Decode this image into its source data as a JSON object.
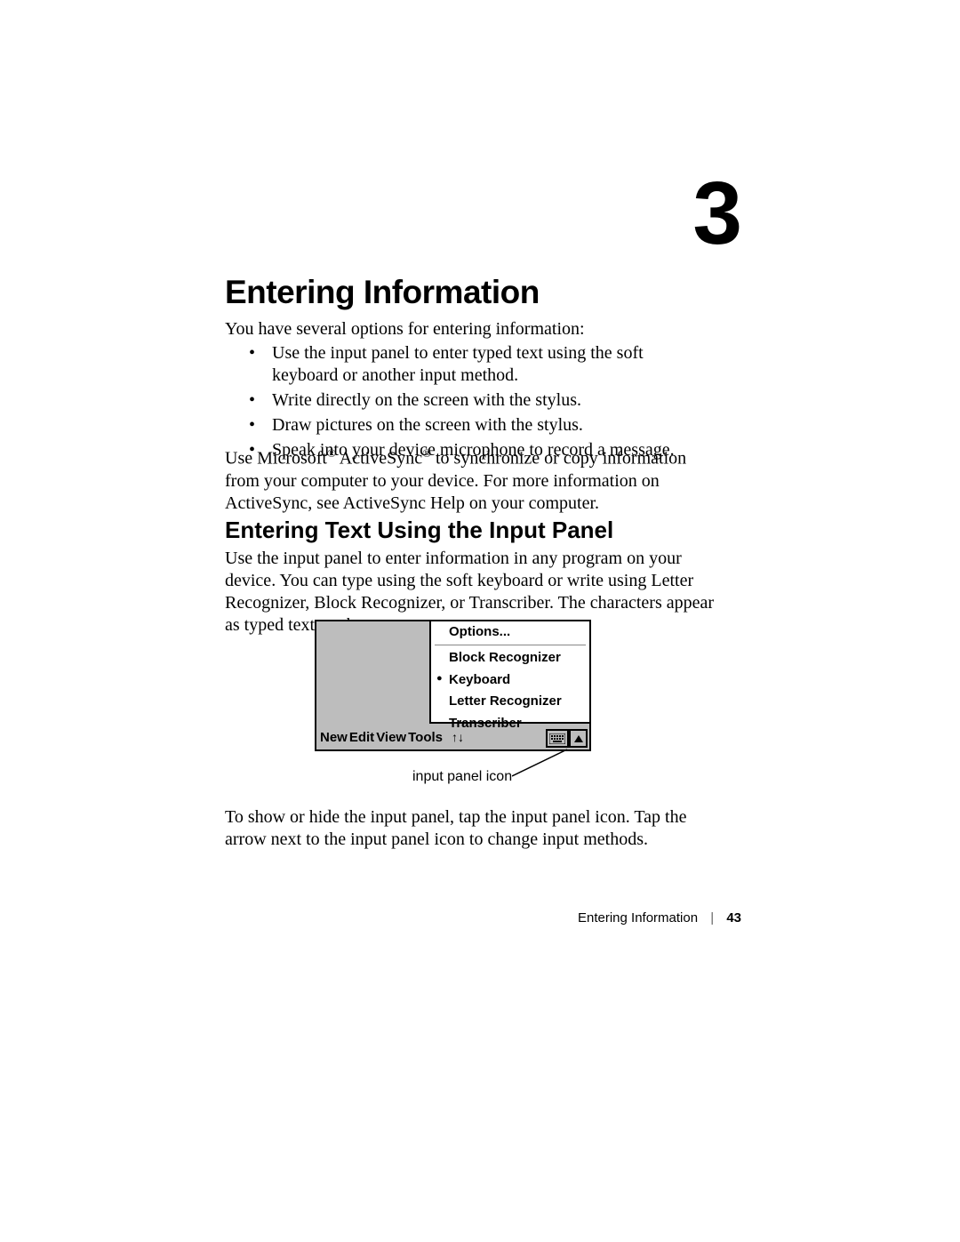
{
  "chapter_number": "3",
  "heading": "Entering Information",
  "intro_line": "You have several options for entering information:",
  "bullets": [
    "Use the input panel to enter typed text using the soft keyboard or another input method.",
    "Write directly on the screen with the stylus.",
    "Draw pictures on the screen with the stylus.",
    "Speak into your device microphone to record a message."
  ],
  "after_list_pre": "Use Microsoft",
  "after_list_mid1": " ActiveSync",
  "after_list_post": " to synchronize or copy information from your computer to your device. For more information on ActiveSync, see ActiveSync Help on your computer.",
  "reg_mark": "®",
  "sub_heading": "Entering Text Using the Input Panel",
  "sub_body": "Use the input panel to enter information in any program on your device. You can type using the soft keyboard or write using Letter Recognizer, Block Recognizer, or Transcriber. The characters appear as typed text on the screen.",
  "ppc": {
    "bar_items": [
      "New",
      "Edit",
      "View",
      "Tools"
    ],
    "updown_glyph": "↑↓",
    "popup": {
      "options": "Options...",
      "items": [
        "Block Recognizer",
        "Keyboard",
        "Letter Recognizer",
        "Transcriber"
      ],
      "selected_index": 1
    }
  },
  "callout_label": "input panel icon",
  "closing_para": "To show or hide the input panel, tap the input panel icon. Tap the arrow next to the input panel icon to change input methods.",
  "footer": {
    "section": "Entering Information",
    "page": "43"
  }
}
